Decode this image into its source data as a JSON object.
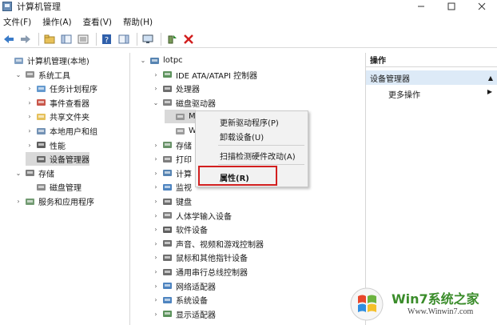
{
  "window": {
    "title": "计算机管理"
  },
  "menu": [
    "文件(F)",
    "操作(A)",
    "查看(V)",
    "帮助(H)"
  ],
  "left_tree": [
    {
      "label": "计算机管理(本地)",
      "level": 0,
      "arrow": "",
      "icon": "computer-management-icon"
    },
    {
      "label": "系统工具",
      "level": 1,
      "arrow": "⌄",
      "icon": "tools-icon"
    },
    {
      "label": "任务计划程序",
      "level": 2,
      "arrow": "›",
      "icon": "clock-icon"
    },
    {
      "label": "事件查看器",
      "level": 2,
      "arrow": "›",
      "icon": "event-viewer-icon"
    },
    {
      "label": "共享文件夹",
      "level": 2,
      "arrow": "›",
      "icon": "shared-folder-icon"
    },
    {
      "label": "本地用户和组",
      "level": 2,
      "arrow": "›",
      "icon": "users-icon"
    },
    {
      "label": "性能",
      "level": 2,
      "arrow": "›",
      "icon": "performance-icon"
    },
    {
      "label": "设备管理器",
      "level": 2,
      "arrow": "",
      "icon": "device-manager-icon",
      "selected": true
    },
    {
      "label": "存储",
      "level": 1,
      "arrow": "⌄",
      "icon": "storage-icon"
    },
    {
      "label": "磁盘管理",
      "level": 2,
      "arrow": "",
      "icon": "disk-management-icon"
    },
    {
      "label": "服务和应用程序",
      "level": 1,
      "arrow": "›",
      "icon": "services-icon"
    }
  ],
  "device_tree": [
    {
      "label": "lotpc",
      "level": 0,
      "arrow": "⌄",
      "icon": "computer-icon"
    },
    {
      "label": "IDE ATA/ATAPI 控制器",
      "level": 1,
      "arrow": "›",
      "icon": "ide-controller-icon"
    },
    {
      "label": "处理器",
      "level": 1,
      "arrow": "›",
      "icon": "processor-icon"
    },
    {
      "label": "磁盘驱动器",
      "level": 1,
      "arrow": "⌄",
      "icon": "disk-drive-icon"
    },
    {
      "label": "M",
      "level": 2,
      "arrow": "",
      "icon": "drive-icon",
      "selected": true
    },
    {
      "label": "W",
      "level": 2,
      "arrow": "",
      "icon": "drive-icon"
    },
    {
      "label": "存储",
      "level": 1,
      "arrow": "›",
      "icon": "storage-controller-icon"
    },
    {
      "label": "打印",
      "level": 1,
      "arrow": "›",
      "icon": "printer-icon"
    },
    {
      "label": "计算",
      "level": 1,
      "arrow": "›",
      "icon": "computer-icon"
    },
    {
      "label": "监视",
      "level": 1,
      "arrow": "›",
      "icon": "monitor-icon"
    },
    {
      "label": "键盘",
      "level": 1,
      "arrow": "›",
      "icon": "keyboard-icon"
    },
    {
      "label": "人体学输入设备",
      "level": 1,
      "arrow": "›",
      "icon": "hid-icon"
    },
    {
      "label": "软件设备",
      "level": 1,
      "arrow": "›",
      "icon": "software-device-icon"
    },
    {
      "label": "声音、视频和游戏控制器",
      "level": 1,
      "arrow": "›",
      "icon": "speaker-icon"
    },
    {
      "label": "鼠标和其他指针设备",
      "level": 1,
      "arrow": "›",
      "icon": "mouse-icon"
    },
    {
      "label": "通用串行总线控制器",
      "level": 1,
      "arrow": "›",
      "icon": "usb-icon"
    },
    {
      "label": "网络适配器",
      "level": 1,
      "arrow": "›",
      "icon": "network-adapter-icon"
    },
    {
      "label": "系统设备",
      "level": 1,
      "arrow": "›",
      "icon": "system-device-icon"
    },
    {
      "label": "显示适配器",
      "level": 1,
      "arrow": "›",
      "icon": "display-adapter-icon"
    }
  ],
  "context_menu": {
    "update_driver": "更新驱动程序(P)",
    "uninstall": "卸载设备(U)",
    "scan": "扫描检测硬件改动(A)",
    "properties": "属性(R)"
  },
  "actions": {
    "header": "操作",
    "section": "设备管理器",
    "more": "更多操作"
  },
  "watermark": {
    "brand": "Win7系统之家",
    "url": "Www.Winwin7.com"
  },
  "colors": {
    "highlight_border": "#d21f1f",
    "action_section_bg": "#ddeaf7",
    "selected_bg": "#d9d9d9"
  }
}
